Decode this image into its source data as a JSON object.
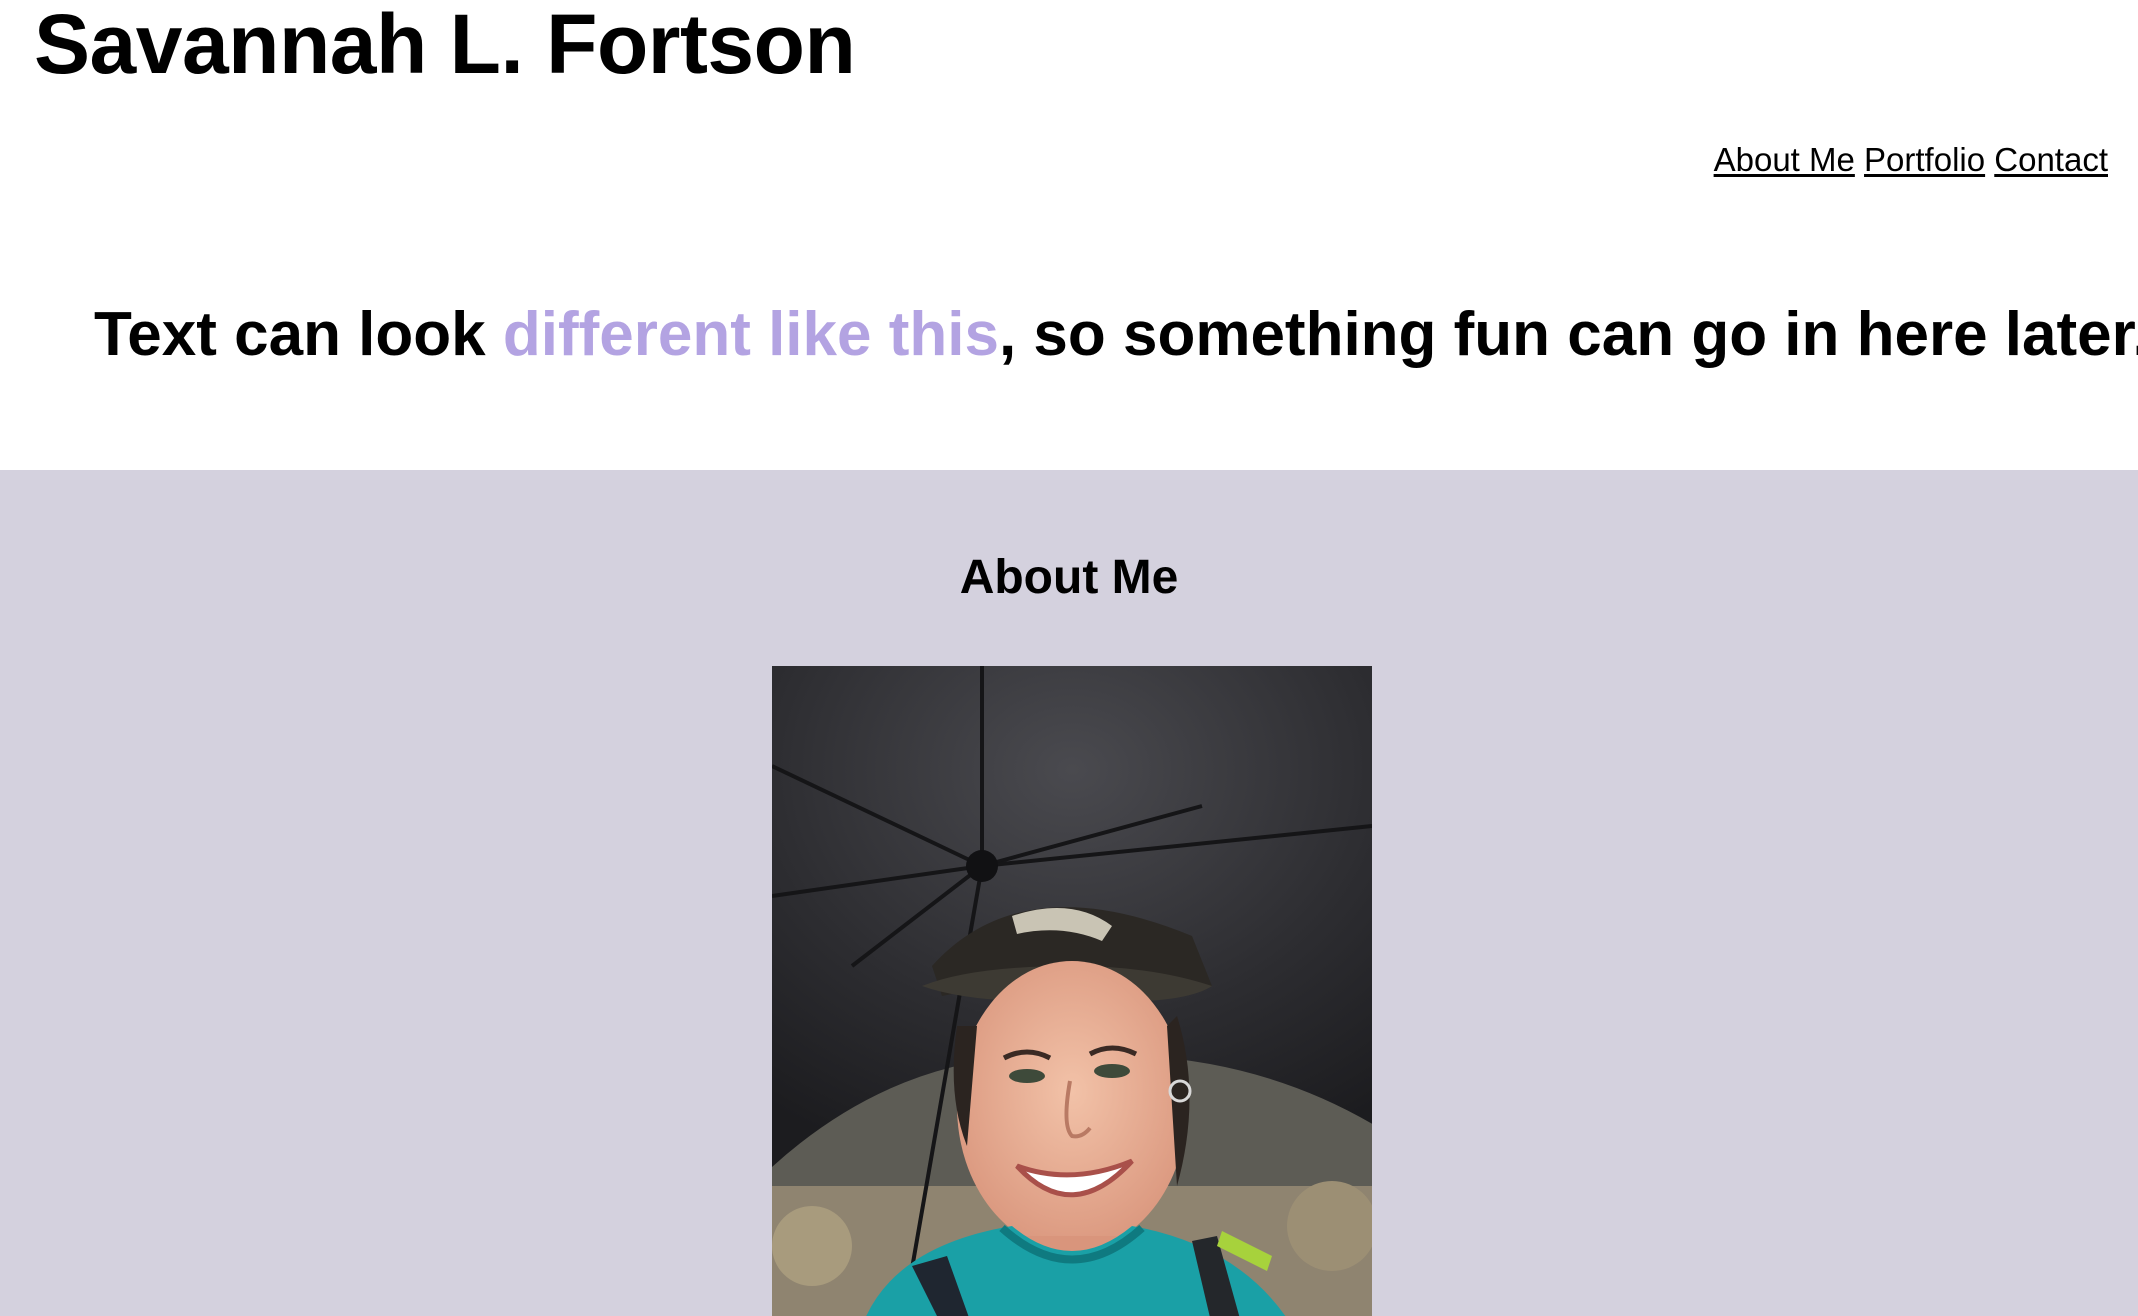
{
  "header": {
    "title": "Savannah L. Fortson"
  },
  "nav": {
    "items": [
      {
        "label": "About Me"
      },
      {
        "label": "Portfolio"
      },
      {
        "label": "Contact"
      }
    ]
  },
  "hero": {
    "text_before": "Text can look ",
    "text_accent": "different like this",
    "text_after": ", so something fun can go in here later...",
    "accent_color": "#b3a3e2"
  },
  "about": {
    "heading": "About Me",
    "background_color": "#d4d1de",
    "photo": {
      "alt": "Smiling person wearing a cap under a black umbrella"
    }
  }
}
